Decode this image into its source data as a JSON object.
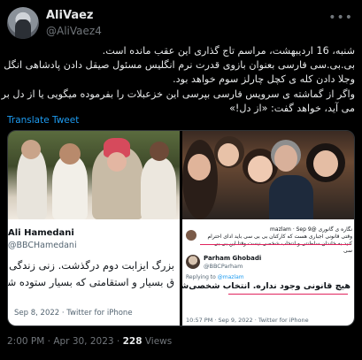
{
  "author": {
    "display_name": "AliVaez",
    "handle": "@AliVaez4"
  },
  "more_icon": "more-icon",
  "tweet_text": {
    "line1": "شنبه، 16 اردیبهشت، مراسم تاج گذاری این عقب مانده است.",
    "line2": "بی.بی.سی فارسی بعنوان بازوی قدرت نرم انگلیس مسئول صیقل دادن پادشاهی انگل ها",
    "line3": "وجلا دادن کله ی کچل چارلز سوم خواهد بود.",
    "line4": "واگر از گماشته ی سرویس فارسی بپرسی این خزعبلات را بفرموده میگویی یا از دل بر",
    "line5": "می آید، خواهد گفت: «از دل!»"
  },
  "translate_label": "Translate Tweet",
  "left_card": {
    "reply_name": "Ali Hamedani",
    "reply_handle": "@BBCHamedani",
    "reply_line1": "بزرگ ایزابت دوم درگذشت. زنی زندگی بی‌نظ",
    "reply_line2": "ق بسیار و استقامتی که بسیار ستوده شد",
    "reply_meta": "Sep 8, 2022 · Twitter for iPhone"
  },
  "right_card": {
    "quoted_header": "نگاره ی گانوری @mazlam · Sep 9",
    "quoted_text": "وقتی قانونی اجباری هست که کارکنان بی بی سی باید ادای احترام کنید به خاندان سلطنتی و انتخاب شخصی نیست وقتا این بی بی سی",
    "reply_name": "Parham Ghobadi",
    "reply_handle": "@BBCParham",
    "replying_prefix": "Replying to",
    "replying_handle": "@mazlam",
    "reply_text": "هیچ قانونی وجود نداره. انتخاب شخصی‌شون است.",
    "reply_meta": "10:57 PM · Sep 9, 2022 · Twitter for iPhone"
  },
  "footer": {
    "timestamp": "2:00 PM · Apr 30, 2023 · ",
    "views_count": "228",
    "views_label": " Views"
  }
}
